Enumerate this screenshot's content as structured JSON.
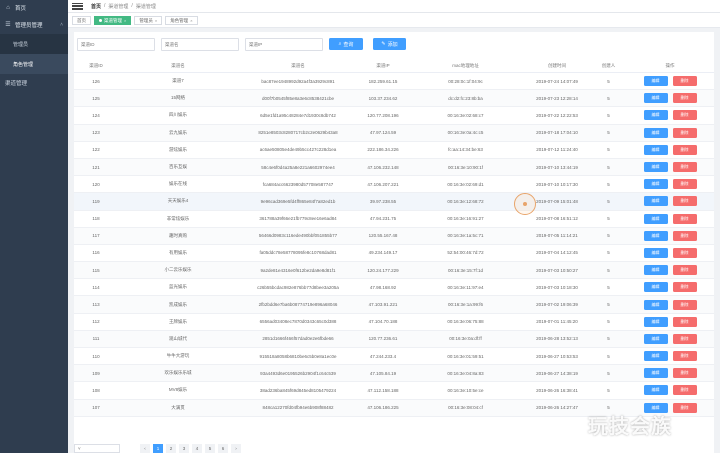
{
  "sidebar": {
    "home_label": "首页",
    "group_label": "管理员管理",
    "sub_items": [
      {
        "label": "管理员",
        "active": false
      },
      {
        "label": "角色管理",
        "active": true
      }
    ],
    "channel_label": "渠道管理"
  },
  "topbar": {
    "breadcrumb": [
      "首页",
      "/",
      "渠道管理",
      "/",
      "渠道管理"
    ]
  },
  "tabs": [
    {
      "label": "首页",
      "active": false
    },
    {
      "label": "渠道管理",
      "active": true
    },
    {
      "label": "管理员",
      "active": false
    },
    {
      "label": "角色管理",
      "active": false
    }
  ],
  "search": {
    "placeholders": [
      "渠道ID",
      "渠道名",
      "渠道IP"
    ],
    "search_button": "查询",
    "add_button": "添加"
  },
  "table": {
    "headers": [
      "渠道ID",
      "渠道名",
      "渠道名",
      "渠道IP",
      "mac地理地址",
      "创建时间",
      "创建人",
      "操作"
    ],
    "edit_label": "编辑",
    "delete_label": "删除",
    "rows": [
      {
        "id": "126",
        "name": "渠道7",
        "hash": "bac87ee1948992d92a4f3a3929c891",
        "ip": "182.259.61.15",
        "mac": "00:28:0c:1f:04:9c",
        "time": "2019-07-24 14:07:49",
        "creator": "5"
      },
      {
        "id": "125",
        "name": "15网络",
        "hash": "d00f7b0545f85e8a3e6c8538421cbe",
        "ip": "103.37.234.62",
        "mac": "dc:d2:fc:23:8b:ba",
        "time": "2019-07-23 12:28:14",
        "creator": "5"
      },
      {
        "id": "124",
        "name": "四川娱乐",
        "hash": "6d5e1fd1a95c48284e7d1930c8db742",
        "ip": "120.77.208.196",
        "mac": "00:16:3e:02:68:c7",
        "time": "2019-07-22 12:22:53",
        "creator": "5"
      },
      {
        "id": "123",
        "name": "云九娱乐",
        "hash": "8251e8503c8280717cb2c2e0629b43a8",
        "ip": "47.97.124.59",
        "mac": "00:16:3e:0a:4c:c5",
        "time": "2019-07-18 17:04:10",
        "creator": "5"
      },
      {
        "id": "122",
        "name": "游炫娱乐",
        "hash": "ac6ae50805e4de49b5cc427c228d1ea",
        "ip": "222.186.34.226",
        "mac": "fc:aa:14:34:be:63",
        "time": "2019-07-12 11:24:40",
        "creator": "5"
      },
      {
        "id": "121",
        "name": "百乐互娱",
        "hash": "58c4e6f0d4a25a8e221a6602974ee4",
        "ip": "47.106.232.148",
        "mac": "00:16:3e:10:90:1f",
        "time": "2019-07-10 13:44:19",
        "creator": "5"
      },
      {
        "id": "120",
        "name": "娱乐在线",
        "hash": "fca684acc6623980d57708e587747",
        "ip": "47.106.207.221",
        "mac": "00:16:3e:02:69:d1",
        "time": "2019-07-10 10:17:30",
        "creator": "5"
      },
      {
        "id": "119",
        "name": "天天娱乐4",
        "hash": "9e96cad369e5fd4ff865e84f7a82ed1b",
        "ip": "39.97.238.55",
        "mac": "00:16:3e:12:68:72",
        "time": "2019-07-09 15:01:48",
        "creator": "5"
      },
      {
        "id": "118",
        "name": "非常炫娱乐",
        "hash": "361788a39f66e21fb779c8ee16e6ad84",
        "ip": "47.94.231.75",
        "mac": "00:16:3e:16:91:27",
        "time": "2019-07-08 16:51:12",
        "creator": "5"
      },
      {
        "id": "117",
        "name": "趣时真购",
        "hash": "56466d0983c116ede490bbf051855b77",
        "ip": "120.55.167.48",
        "mac": "00:16:3e:1a:5c:71",
        "time": "2019-07-05 11:14:21",
        "creator": "5"
      },
      {
        "id": "116",
        "name": "有用娱乐",
        "hash": "fa05ddc78e58778095fe8c10768dad81",
        "ip": "49.234.149.17",
        "mac": "52:54:00:46:7d:72",
        "time": "2019-07-04 14:12:45",
        "creator": "5"
      },
      {
        "id": "115",
        "name": "小二云乐娱乐",
        "hash": "9a2de81e4316e0f612be2da9e8d81f1",
        "ip": "120.24.177.229",
        "mac": "00:16:3e:15:7f:1d",
        "time": "2019-07-03 10:50:27",
        "creator": "5"
      },
      {
        "id": "114",
        "name": "蓝光娱乐",
        "hash": "c26b55bcdac982e876bb77d8bee3a205a",
        "ip": "47.98.168.92",
        "mac": "00:16:3e:11:97:e4",
        "time": "2019-07-03 10:18:30",
        "creator": "5"
      },
      {
        "id": "113",
        "name": "凯成娱乐",
        "hash": "2fb2bdd6e7ba6b08774719e896a68046",
        "ip": "47.103.91.221",
        "mac": "00:16:3e:1a:99:f6",
        "time": "2019-07-02 19:06:39",
        "creator": "5"
      },
      {
        "id": "112",
        "name": "王牌娱乐",
        "hash": "6556ad03408ec7870d0343c65c0d388",
        "ip": "47.104.70.188",
        "mac": "00:16:3e:06:75:88",
        "time": "2019-07-01 11:45:20",
        "creator": "5"
      },
      {
        "id": "111",
        "name": "观山城代",
        "hash": "2851d1666f466f57dad0e2e6fbde66",
        "ip": "120.77.236.61",
        "mac": "00:16:3e:0a:df:ff",
        "time": "2019-06-28 13:52:13",
        "creator": "5"
      },
      {
        "id": "110",
        "name": "牛牛大游玩",
        "hash": "915518a8058b6810be6c5b0e8a1ec0e",
        "ip": "47.244.233.4",
        "mac": "00:16:3e:01:59:51",
        "time": "2019-06-27 10:53:53",
        "creator": "5"
      },
      {
        "id": "109",
        "name": "欢乐娱乐乐城",
        "hash": "93a4493d6e0195526b2904f1c64c539",
        "ip": "47.105.84.19",
        "mac": "00:16:3e:04:8a:83",
        "time": "2019-06-27 14:38:19",
        "creator": "5"
      },
      {
        "id": "108",
        "name": "MV8娱乐",
        "hash": "38ad236ba845f69d845ed8105479224",
        "ip": "47.112.158.188",
        "mac": "00:16:3e:10:5e:ce",
        "time": "2019-06-26 16:38:41",
        "creator": "5"
      },
      {
        "id": "107",
        "name": "大满贯",
        "hash": "848ca12270fd04fb94e6b908f88482",
        "ip": "47.106.186.225",
        "mac": "00:16:3e:08:04:cf",
        "time": "2019-06-26 14:27:47",
        "creator": "5"
      }
    ]
  },
  "pagination": {
    "pages": [
      "1",
      "2",
      "3",
      "4",
      "5",
      "6"
    ],
    "active_page": "1"
  },
  "watermark": "玩技会族"
}
